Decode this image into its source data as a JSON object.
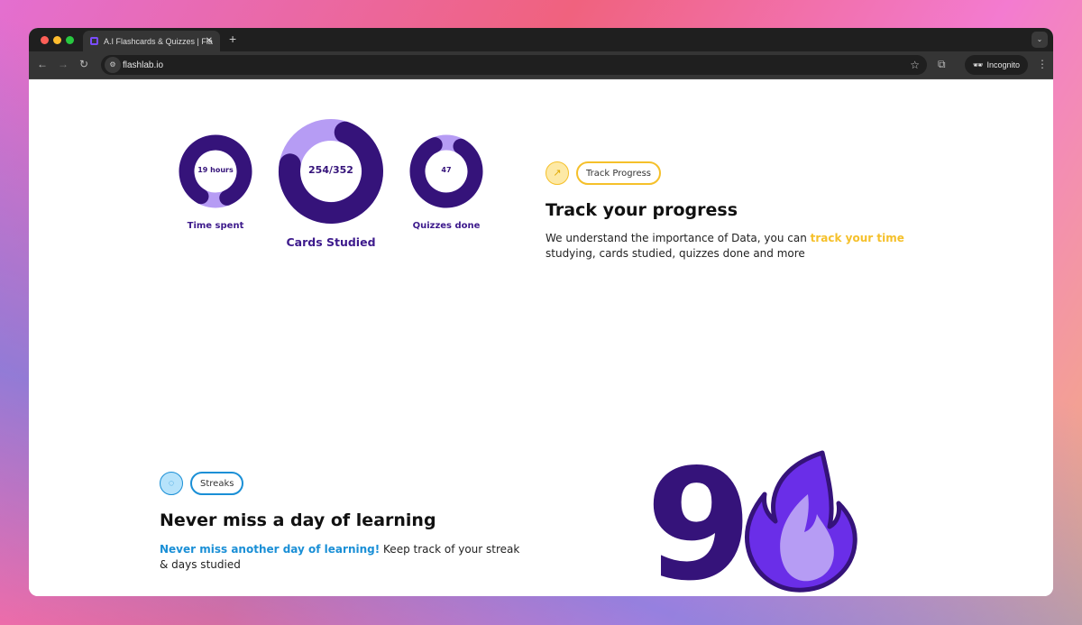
{
  "browser": {
    "tab_title": "A.I Flashcards & Quizzes | Fla",
    "url": "flashlab.io",
    "profile": "Incognito"
  },
  "progress": {
    "stats": [
      {
        "label": "Time spent",
        "value": "19 hours",
        "fraction": 0.85
      },
      {
        "label": "Cards Studied",
        "value": "254/352",
        "fraction": 0.72
      },
      {
        "label": "Quizzes done",
        "value": "47",
        "fraction": 0.85
      }
    ],
    "badge": "Track Progress",
    "title": "Track your progress",
    "desc_pre": "We understand the importance of Data, you can ",
    "desc_highlight": "track your time",
    "desc_post": " studying, cards studied, quizzes done and more"
  },
  "streaks": {
    "badge": "Streaks",
    "title": "Never miss a day of learning",
    "desc_highlight": "Never miss another day of learning!",
    "desc_post": " Keep track of your streak & days studied",
    "count": "9"
  },
  "colors": {
    "dark": "#35137a",
    "light": "#b69cf4",
    "yellow": "#f5c02a",
    "blue": "#1a8fd6"
  }
}
